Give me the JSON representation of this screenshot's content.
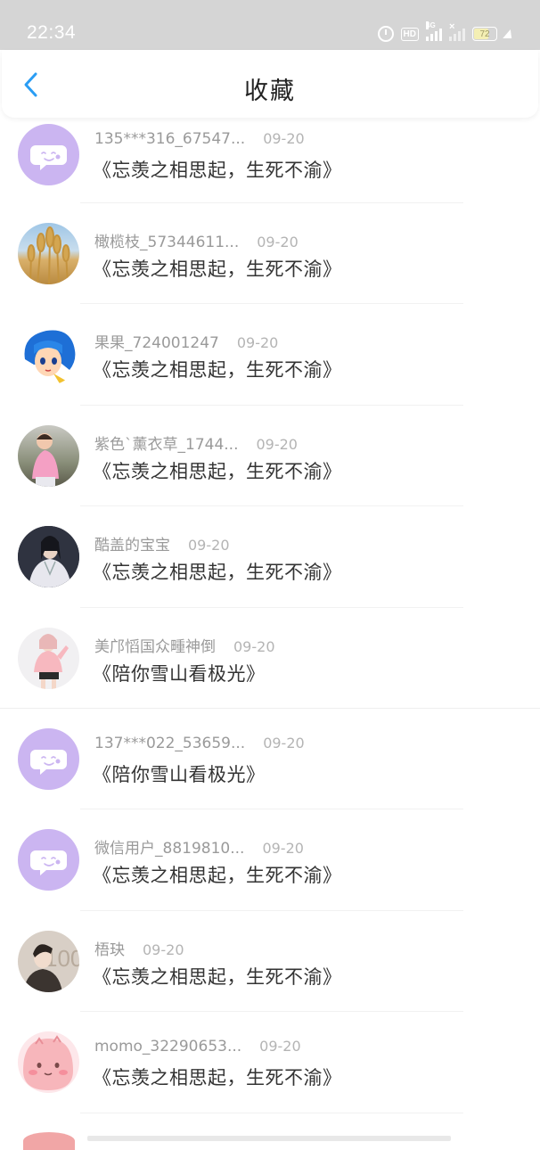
{
  "status_bar": {
    "time": "22:34",
    "hd": "HD",
    "network": "4G",
    "battery": "72"
  },
  "header": {
    "title": "收藏"
  },
  "favorites": [
    {
      "user": "135***316_67547...",
      "date": "09-20",
      "title": "《忘羡之相思起，生死不渝》",
      "avatar": "default"
    },
    {
      "user": "橄榄枝_57344611...",
      "date": "09-20",
      "title": "《忘羡之相思起，生死不渝》",
      "avatar": "wheat"
    },
    {
      "user": "果果_724001247",
      "date": "09-20",
      "title": "《忘羡之相思起，生死不渝》",
      "avatar": "anime"
    },
    {
      "user": "紫色`薰衣草_1744...",
      "date": "09-20",
      "title": "《忘羡之相思起，生死不渝》",
      "avatar": "child"
    },
    {
      "user": "酷盖的宝宝",
      "date": "09-20",
      "title": "《忘羡之相思起，生死不渝》",
      "avatar": "costume"
    },
    {
      "user": "美邝慆国众畽神倒",
      "date": "09-20",
      "title": "《陪你雪山看极光》",
      "avatar": "girl"
    },
    {
      "user": "137***022_53659...",
      "date": "09-20",
      "title": "《陪你雪山看极光》",
      "avatar": "default"
    },
    {
      "user": "微信用户_8819810...",
      "date": "09-20",
      "title": "《忘羡之相思起，生死不渝》",
      "avatar": "default"
    },
    {
      "user": "梧玦",
      "date": "09-20",
      "title": "《忘羡之相思起，生死不渝》",
      "avatar": "man"
    },
    {
      "user": "momo_32290653...",
      "date": "09-20",
      "title": "《忘羡之相思起，生死不渝》",
      "avatar": "pink"
    }
  ],
  "colors": {
    "accent": "#2a9df4",
    "default_avatar": "#cbb5f1"
  }
}
